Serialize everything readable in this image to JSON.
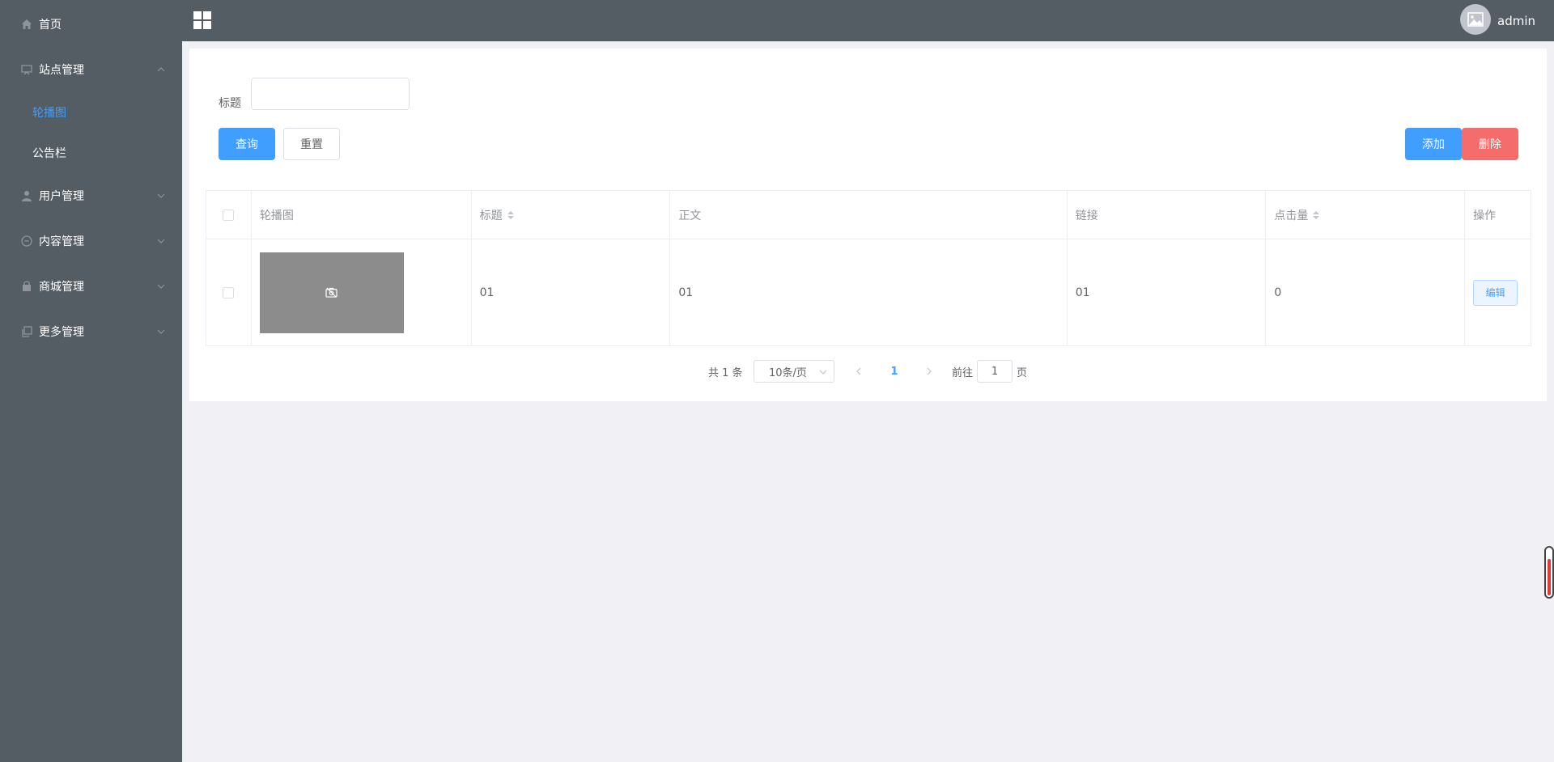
{
  "sidebar": {
    "items": [
      {
        "label": "首页",
        "icon": "home-icon"
      },
      {
        "label": "站点管理",
        "icon": "monitor-icon",
        "expanded": true,
        "children": [
          {
            "label": "轮播图",
            "active": true
          },
          {
            "label": "公告栏"
          }
        ]
      },
      {
        "label": "用户管理",
        "icon": "user-icon"
      },
      {
        "label": "内容管理",
        "icon": "chat-icon"
      },
      {
        "label": "商城管理",
        "icon": "shop-icon"
      },
      {
        "label": "更多管理",
        "icon": "copy-icon"
      }
    ]
  },
  "header": {
    "username": "admin"
  },
  "search": {
    "title_label": "标题",
    "title_value": "",
    "query_label": "查询",
    "reset_label": "重置",
    "add_label": "添加",
    "delete_label": "删除"
  },
  "table": {
    "columns": [
      "轮播图",
      "标题",
      "正文",
      "链接",
      "点击量",
      "操作"
    ],
    "rows": [
      {
        "title": "01",
        "content": "01",
        "link": "01",
        "clicks": "0",
        "action": "编辑"
      }
    ]
  },
  "pagination": {
    "total": "共 1 条",
    "page_size": "10条/页",
    "current_page": "1",
    "goto_label": "前往",
    "goto_value": "1",
    "page_suffix": "页"
  },
  "colors": {
    "sidebar_bg": "#545c64",
    "primary": "#409eff",
    "danger": "#f56c6c",
    "page_bg": "#f0f0f5"
  }
}
